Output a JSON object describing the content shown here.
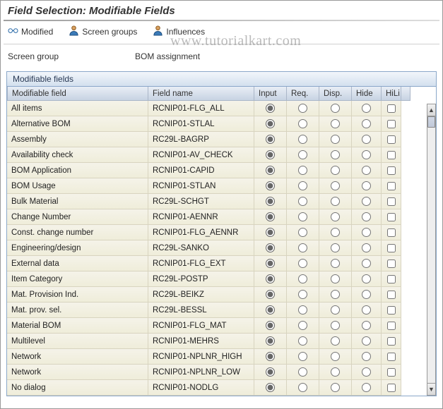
{
  "title": "Field Selection: Modifiable Fields",
  "watermark": "www.tutorialkart.com",
  "toolbar": {
    "modified": "Modified",
    "screen_groups": "Screen groups",
    "influences": "Influences"
  },
  "screen_group": {
    "label": "Screen group",
    "value": "BOM assignment"
  },
  "panel": {
    "title": "Modifiable fields"
  },
  "columns": {
    "c0": "Modifiable field",
    "c1": "Field name",
    "c2": "Input",
    "c3": "Req.",
    "c4": "Disp.",
    "c5": "Hide",
    "c6": "HiLi"
  },
  "rows": [
    {
      "label": "All items",
      "field": "RCNIP01-FLG_ALL",
      "sel": "input",
      "hili": false
    },
    {
      "label": "Alternative BOM",
      "field": "RCNIP01-STLAL",
      "sel": "input",
      "hili": false
    },
    {
      "label": "Assembly",
      "field": "RC29L-BAGRP",
      "sel": "input",
      "hili": false
    },
    {
      "label": "Availability check",
      "field": "RCNIP01-AV_CHECK",
      "sel": "input",
      "hili": false
    },
    {
      "label": "BOM Application",
      "field": "RCNIP01-CAPID",
      "sel": "input",
      "hili": false
    },
    {
      "label": "BOM Usage",
      "field": "RCNIP01-STLAN",
      "sel": "input",
      "hili": false
    },
    {
      "label": "Bulk Material",
      "field": "RC29L-SCHGT",
      "sel": "input",
      "hili": false
    },
    {
      "label": "Change Number",
      "field": "RCNIP01-AENNR",
      "sel": "input",
      "hili": false
    },
    {
      "label": "Const. change number",
      "field": "RCNIP01-FLG_AENNR",
      "sel": "input",
      "hili": false
    },
    {
      "label": "Engineering/design",
      "field": "RC29L-SANKO",
      "sel": "input",
      "hili": false
    },
    {
      "label": "External data",
      "field": "RCNIP01-FLG_EXT",
      "sel": "input",
      "hili": false
    },
    {
      "label": "Item Category",
      "field": "RC29L-POSTP",
      "sel": "input",
      "hili": false
    },
    {
      "label": "Mat. Provision Ind.",
      "field": "RC29L-BEIKZ",
      "sel": "input",
      "hili": false
    },
    {
      "label": "Mat. prov. sel.",
      "field": "RC29L-BESSL",
      "sel": "input",
      "hili": false
    },
    {
      "label": "Material BOM",
      "field": "RCNIP01-FLG_MAT",
      "sel": "input",
      "hili": false
    },
    {
      "label": "Multilevel",
      "field": "RCNIP01-MEHRS",
      "sel": "input",
      "hili": false
    },
    {
      "label": "Network",
      "field": "RCNIP01-NPLNR_HIGH",
      "sel": "input",
      "hili": false
    },
    {
      "label": "Network",
      "field": "RCNIP01-NPLNR_LOW",
      "sel": "input",
      "hili": false
    },
    {
      "label": "No dialog",
      "field": "RCNIP01-NODLG",
      "sel": "input",
      "hili": false
    }
  ]
}
